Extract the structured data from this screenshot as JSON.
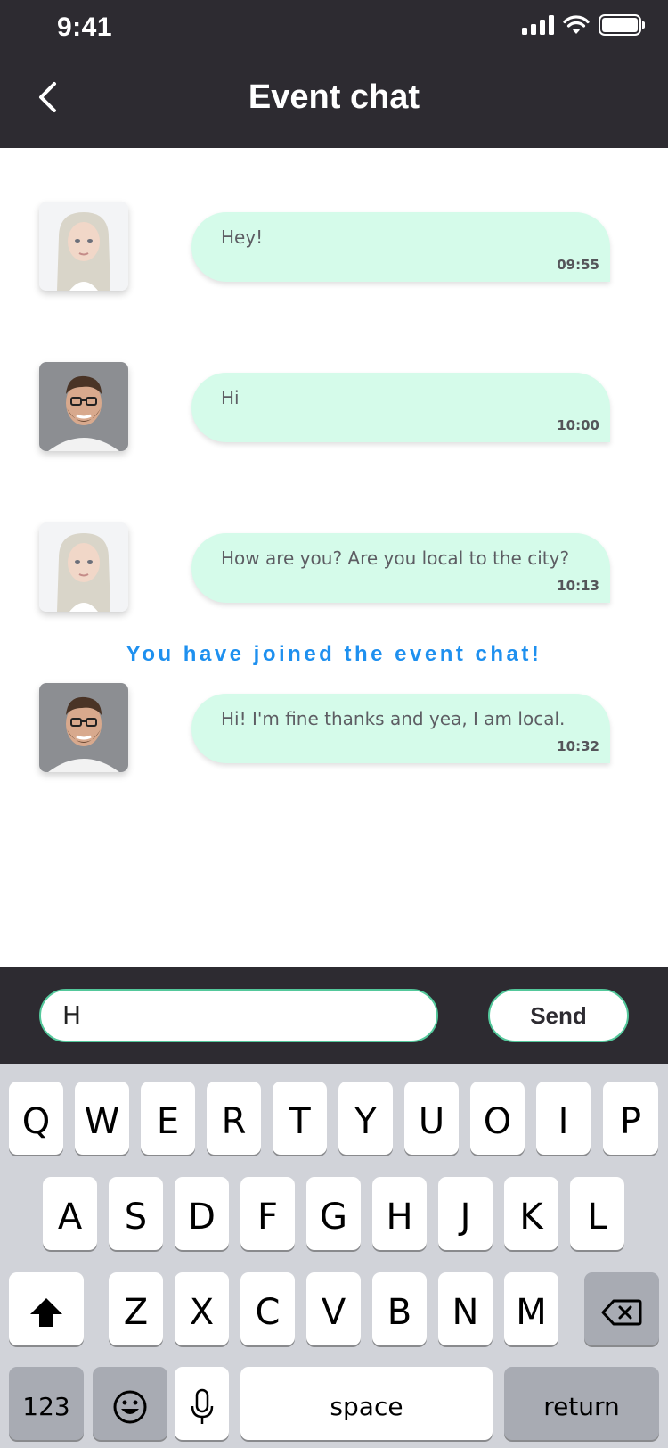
{
  "status": {
    "time": "9:41"
  },
  "header": {
    "title": "Event chat"
  },
  "messages": [
    {
      "avatar": "blonde-woman-avatar",
      "text": "Hey!",
      "time": "09:55"
    },
    {
      "avatar": "bearded-man-avatar",
      "text": "Hi",
      "time": "10:00"
    },
    {
      "avatar": "blonde-woman-avatar",
      "text": "How are you? Are you local to the city?",
      "time": "10:13"
    },
    {
      "avatar": "bearded-man-avatar",
      "text": "Hi! I'm fine thanks and yea, I am local.",
      "time": "10:32"
    }
  ],
  "notice": "You have joined the event chat!",
  "compose": {
    "value": "H",
    "send_label": "Send"
  },
  "keyboard": {
    "row1": [
      "Q",
      "W",
      "E",
      "R",
      "T",
      "Y",
      "U",
      "O",
      "I",
      "P"
    ],
    "row2": [
      "A",
      "S",
      "D",
      "F",
      "G",
      "H",
      "J",
      "K",
      "L"
    ],
    "row3": [
      "Z",
      "X",
      "C",
      "V",
      "B",
      "N",
      "M"
    ],
    "numbers_label": "123",
    "space_label": "space",
    "return_label": "return"
  },
  "colors": {
    "header_bg": "#2d2b31",
    "bubble_bg": "#d5fbea",
    "notice": "#1e90ef",
    "accent_border": "#53c89b",
    "keyboard_bg": "#d1d3d9"
  }
}
